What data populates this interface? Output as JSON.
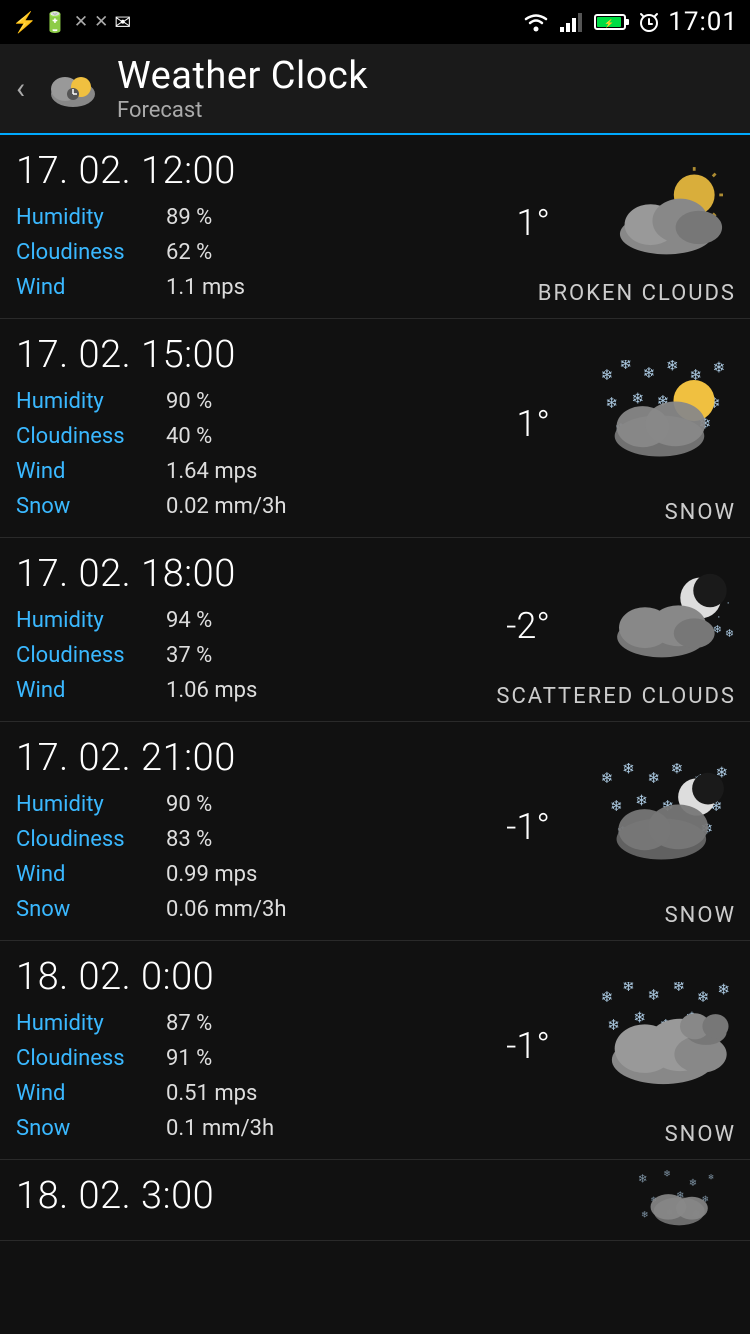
{
  "statusBar": {
    "leftIcons": [
      "usb",
      "sim",
      "signal-x1",
      "signal-x2",
      "email"
    ],
    "rightIcons": [
      "wifi",
      "signal",
      "battery",
      "alarm"
    ],
    "time": "17:01"
  },
  "header": {
    "title": "Weather Clock",
    "subtitle": "Forecast",
    "backLabel": "‹"
  },
  "forecasts": [
    {
      "datetime": "17. 02. 12:00",
      "stats": [
        {
          "label": "Humidity",
          "value": "89 %"
        },
        {
          "label": "Cloudiness",
          "value": "62 %"
        },
        {
          "label": "Wind",
          "value": "1.1 mps"
        }
      ],
      "temperature": "1°",
      "condition": "BROKEN CLOUDS",
      "iconType": "broken-clouds"
    },
    {
      "datetime": "17. 02. 15:00",
      "stats": [
        {
          "label": "Humidity",
          "value": "90 %"
        },
        {
          "label": "Cloudiness",
          "value": "40 %"
        },
        {
          "label": "Wind",
          "value": "1.64 mps"
        },
        {
          "label": "Snow",
          "value": "0.02 mm/3h"
        }
      ],
      "temperature": "1°",
      "condition": "SNOW",
      "iconType": "snow-sun"
    },
    {
      "datetime": "17. 02. 18:00",
      "stats": [
        {
          "label": "Humidity",
          "value": "94 %"
        },
        {
          "label": "Cloudiness",
          "value": "37 %"
        },
        {
          "label": "Wind",
          "value": "1.06 mps"
        }
      ],
      "temperature": "-2°",
      "condition": "SCATTERED CLOUDS",
      "iconType": "scattered-night"
    },
    {
      "datetime": "17. 02. 21:00",
      "stats": [
        {
          "label": "Humidity",
          "value": "90 %"
        },
        {
          "label": "Cloudiness",
          "value": "83 %"
        },
        {
          "label": "Wind",
          "value": "0.99 mps"
        },
        {
          "label": "Snow",
          "value": "0.06 mm/3h"
        }
      ],
      "temperature": "-1°",
      "condition": "SNOW",
      "iconType": "snow-night"
    },
    {
      "datetime": "18. 02. 0:00",
      "stats": [
        {
          "label": "Humidity",
          "value": "87 %"
        },
        {
          "label": "Cloudiness",
          "value": "91 %"
        },
        {
          "label": "Wind",
          "value": "0.51 mps"
        },
        {
          "label": "Snow",
          "value": "0.1 mm/3h"
        }
      ],
      "temperature": "-1°",
      "condition": "SNOW",
      "iconType": "snow-cloud"
    },
    {
      "datetime": "18. 02. 3:00",
      "stats": [],
      "temperature": "",
      "condition": "",
      "iconType": "snow-cloud2"
    }
  ]
}
